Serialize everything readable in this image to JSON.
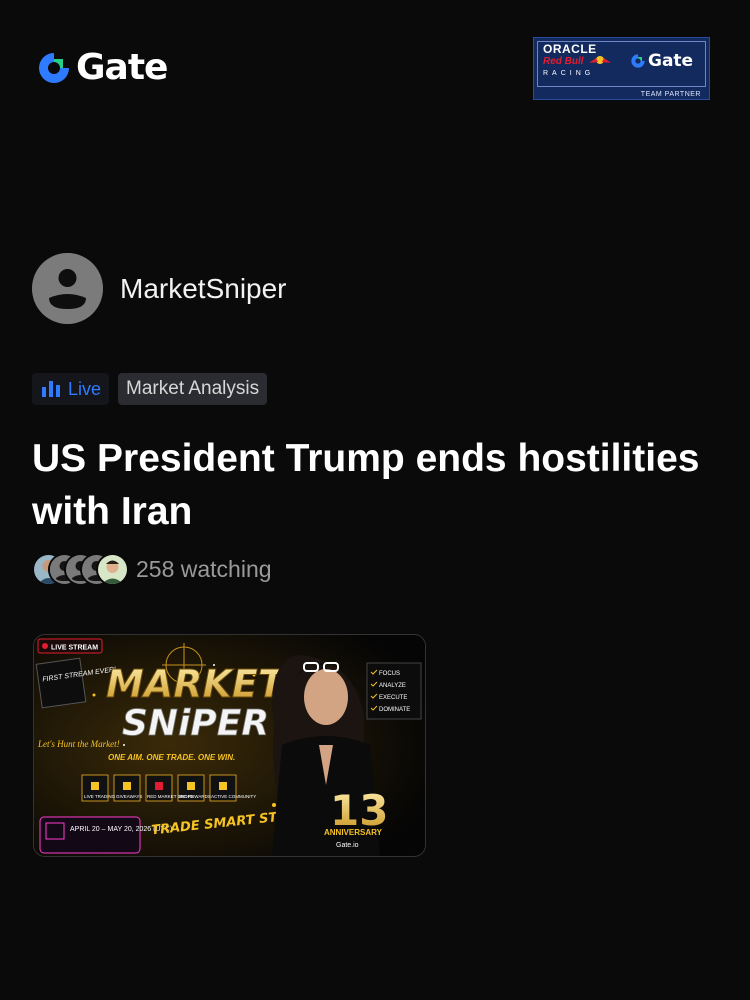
{
  "header": {
    "brand": "Gate",
    "partner": {
      "oracle": "ORACLE",
      "redbull": "Red Bull",
      "racing": "RACING",
      "brand": "Gate",
      "team": "TEAM PARTNER"
    }
  },
  "author": {
    "name": "MarketSniper"
  },
  "tags": {
    "live": "Live",
    "category": "Market Analysis"
  },
  "post": {
    "title": "US President Trump ends hostilities with Iran"
  },
  "viewers": {
    "text": "258 watching"
  },
  "thumbnail": {
    "badge": "LIVE STREAM",
    "first": "FIRST STREAM EVER!",
    "title1": "MARKET",
    "title2": "SNiPER",
    "tagline": "ONE AIM. ONE TRADE. ONE WIN.",
    "hunt": "Let's Hunt the Market!",
    "features": [
      "LIVE TRADING",
      "GIVEAWAYS",
      "RED MARKET DROPS",
      "BIG REWARDS",
      "ACTIVE COMMUNITY"
    ],
    "checklist": [
      "FOCUS",
      "ANALYZE",
      "EXECUTE",
      "DOMINATE"
    ],
    "dates": "APRIL 20 – MAY 20, 2026 (UTC)",
    "trade": "TRADE SMART STAY CALM",
    "anniversary_num": "13",
    "anniversary": "ANNIVERSARY",
    "gate": "Gate.io"
  },
  "colors": {
    "accent": "#2f7bff",
    "bg": "#0a0a0b"
  }
}
